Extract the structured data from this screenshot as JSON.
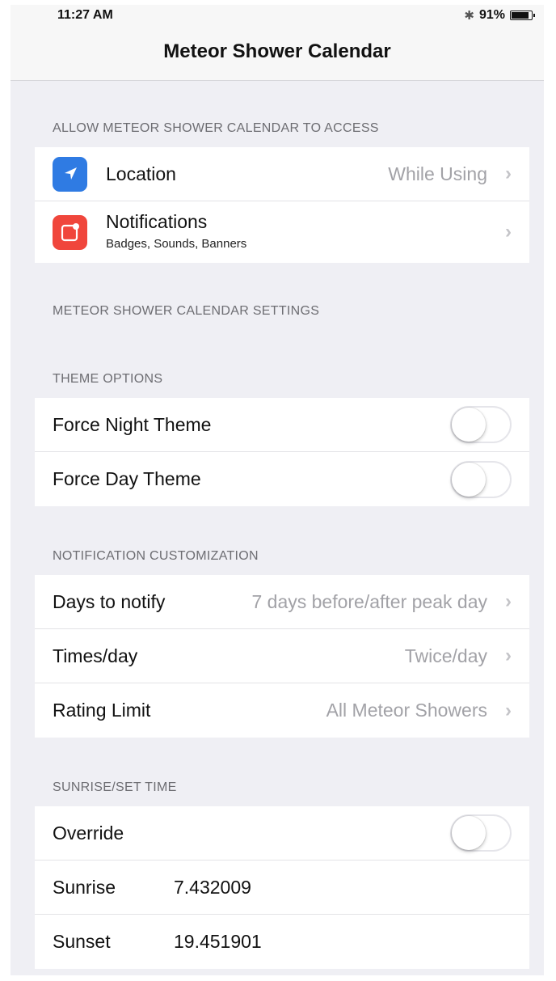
{
  "status_bar": {
    "time": "11:27 AM",
    "bluetooth_icon": "bluetooth-icon",
    "battery_text": "91%",
    "battery_level": 0.91
  },
  "nav": {
    "title": "Meteor Shower Calendar"
  },
  "access": {
    "header": "ALLOW METEOR SHOWER CALENDAR TO ACCESS",
    "location": {
      "label": "Location",
      "value": "While Using",
      "icon": "location-arrow-icon",
      "color": "#2f7be3"
    },
    "notifications": {
      "label": "Notifications",
      "sublabel": "Badges, Sounds, Banners",
      "icon": "notifications-icon",
      "color": "#f0463c"
    }
  },
  "settings_header": "METEOR SHOWER CALENDAR SETTINGS",
  "theme": {
    "header": "THEME OPTIONS",
    "force_night": {
      "label": "Force Night Theme",
      "on": false
    },
    "force_day": {
      "label": "Force Day Theme",
      "on": false
    }
  },
  "notification_custom": {
    "header": "NOTIFICATION CUSTOMIZATION",
    "days": {
      "label": "Days to notify",
      "value": "7 days before/after peak day"
    },
    "times": {
      "label": "Times/day",
      "value": "Twice/day"
    },
    "rating": {
      "label": "Rating Limit",
      "value": "All Meteor Showers"
    }
  },
  "sun": {
    "header": "SUNRISE/SET TIME",
    "override": {
      "label": "Override",
      "on": false
    },
    "sunrise": {
      "label": "Sunrise",
      "value": "7.432009"
    },
    "sunset": {
      "label": "Sunset",
      "value": "19.451901"
    }
  },
  "chevron": "›"
}
